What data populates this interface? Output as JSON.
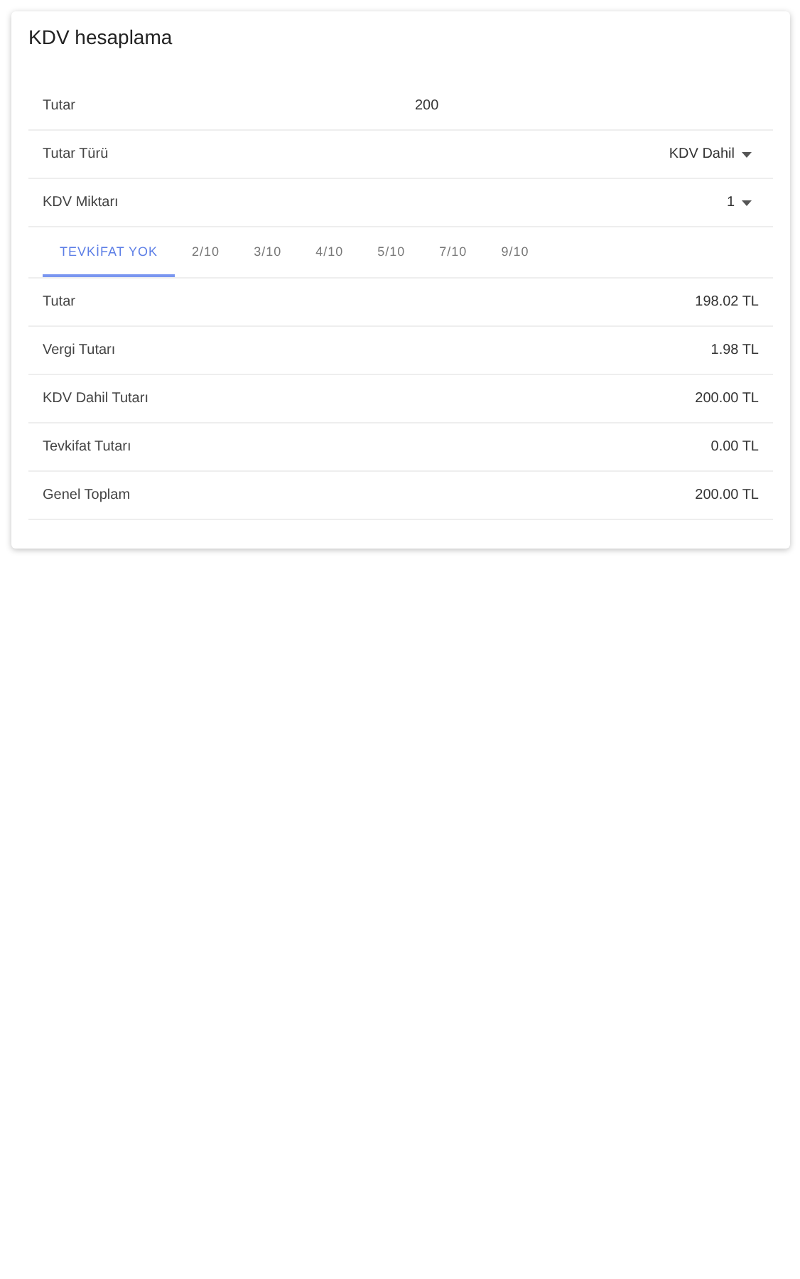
{
  "card": {
    "title": "KDV hesaplama"
  },
  "inputs": [
    {
      "kind": "text",
      "label": "Tutar",
      "value": "200"
    },
    {
      "kind": "select",
      "label": "Tutar Türü",
      "value": "KDV Dahil"
    },
    {
      "kind": "select",
      "label": "KDV Miktarı",
      "value": "1"
    }
  ],
  "tabs": [
    {
      "label": "TEVKİFAT YOK",
      "selected": true
    },
    {
      "label": "2/10",
      "selected": false
    },
    {
      "label": "3/10",
      "selected": false
    },
    {
      "label": "4/10",
      "selected": false
    },
    {
      "label": "5/10",
      "selected": false
    },
    {
      "label": "7/10",
      "selected": false
    },
    {
      "label": "9/10",
      "selected": false
    }
  ],
  "results": [
    {
      "label": "Tutar",
      "value": "198.02 TL"
    },
    {
      "label": "Vergi Tutarı",
      "value": "1.98 TL"
    },
    {
      "label": "KDV Dahil Tutarı",
      "value": "200.00 TL"
    },
    {
      "label": "Tevkifat Tutarı",
      "value": "0.00 TL"
    },
    {
      "label": "Genel Toplam",
      "value": "200.00 TL"
    }
  ]
}
